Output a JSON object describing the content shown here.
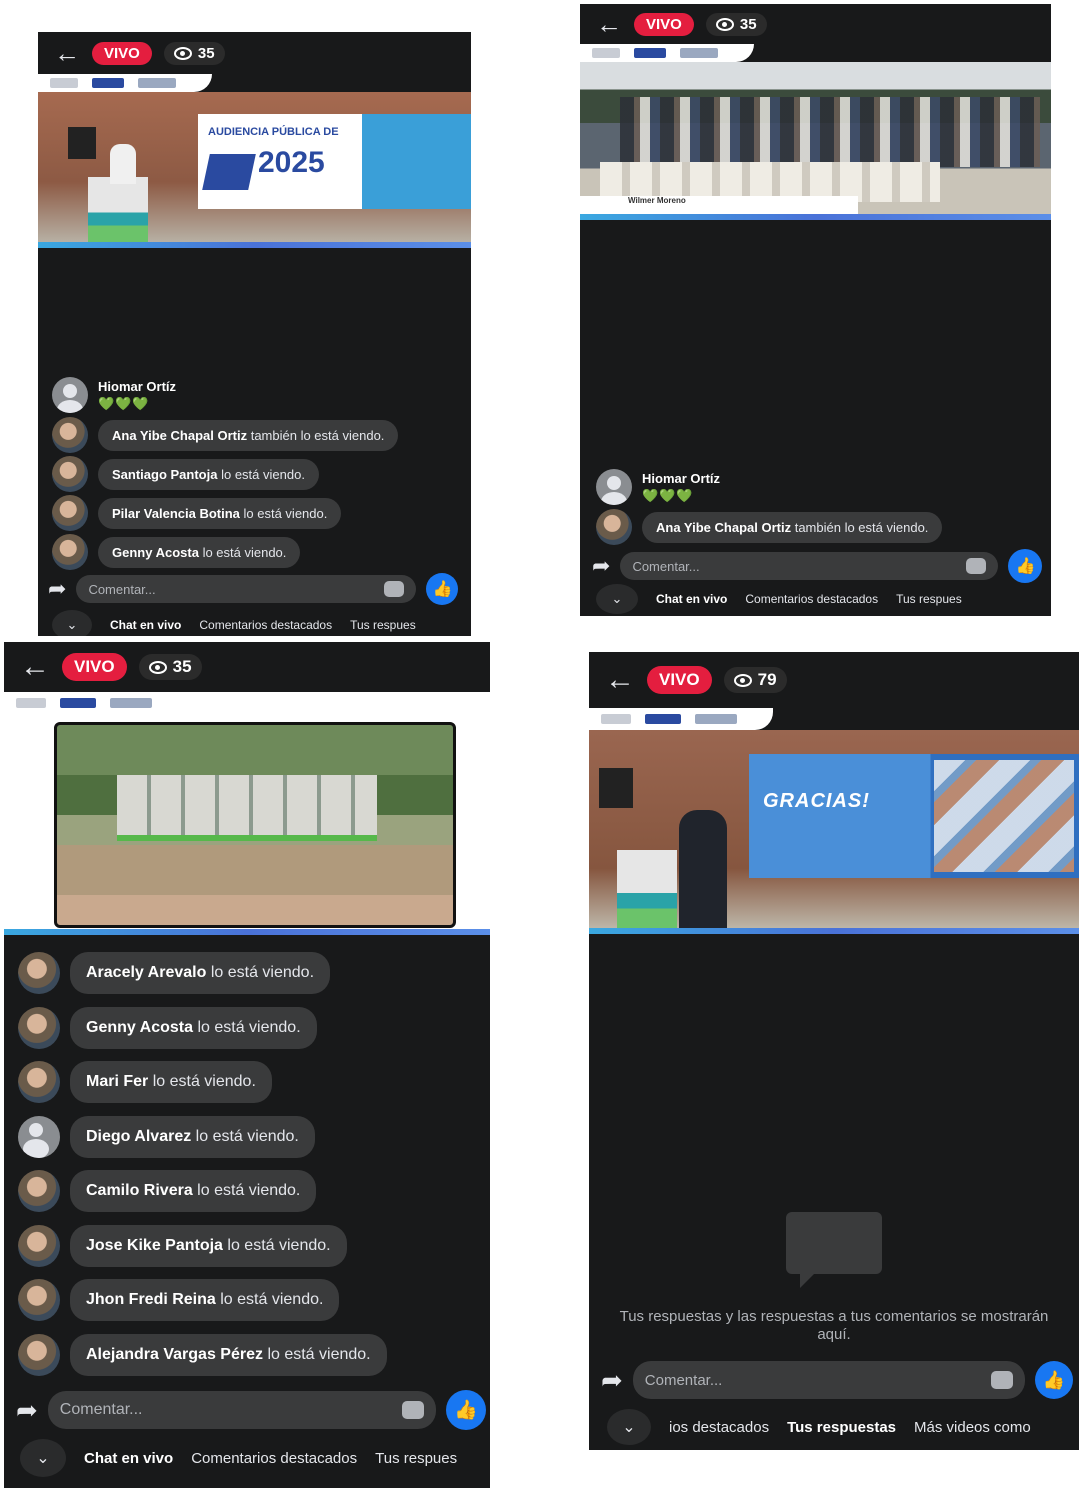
{
  "panels": {
    "p1": {
      "live_badge": "VIVO",
      "view_count": "35",
      "comments": [
        {
          "name": "Hiomar Ortíz",
          "hearts": "💚💚💚"
        },
        {
          "name": "Ana Yibe Chapal Ortiz",
          "text": "también lo está viendo."
        },
        {
          "name": "Santiago Pantoja",
          "text": "lo está viendo."
        },
        {
          "name": "Pilar Valencia Botina",
          "text": "lo está viendo."
        },
        {
          "name": "Genny Acosta",
          "text": "lo está viendo."
        }
      ],
      "comment_placeholder": "Comentar...",
      "tabs": [
        "Chat en vivo",
        "Comentarios destacados",
        "Tus respues"
      ],
      "screen_title": "AUDIENCIA PÚBLICA DE",
      "screen_year": "2025"
    },
    "p2": {
      "live_badge": "VIVO",
      "view_count": "35",
      "caption_name": "Wilmer Moreno",
      "comments": [
        {
          "name": "Hiomar Ortíz",
          "hearts": "💚💚💚"
        },
        {
          "name": "Ana Yibe Chapal Ortiz",
          "text": "también lo está viendo."
        }
      ],
      "comment_placeholder": "Comentar...",
      "tabs": [
        "Chat en vivo",
        "Comentarios destacados",
        "Tus respues"
      ]
    },
    "p3": {
      "live_badge": "VIVO",
      "view_count": "35",
      "comments": [
        {
          "name": "Aracely Arevalo",
          "text": "lo está viendo."
        },
        {
          "name": "Genny Acosta",
          "text": "lo está viendo."
        },
        {
          "name": "Mari Fer",
          "text": "lo está viendo."
        },
        {
          "name": "Diego Alvarez",
          "text": "lo está viendo."
        },
        {
          "name": "Camilo Rivera",
          "text": "lo está viendo."
        },
        {
          "name": "Jose Kike Pantoja",
          "text": "lo está viendo."
        },
        {
          "name": "Jhon Fredi Reina",
          "text": "lo está viendo."
        },
        {
          "name": "Alejandra Vargas Pérez",
          "text": "lo está viendo."
        }
      ],
      "comment_placeholder": "Comentar...",
      "tabs": [
        "Chat en vivo",
        "Comentarios destacados",
        "Tus respues"
      ]
    },
    "p4": {
      "live_badge": "VIVO",
      "view_count": "79",
      "screen_title": "GRACIAS!",
      "empty_message": "Tus respuestas y las respuestas a tus comentarios se mostrarán aquí.",
      "comment_placeholder": "Comentar...",
      "tabs": [
        "ios destacados",
        "Tus respuestas",
        "Más videos como"
      ]
    }
  },
  "colors": {
    "live_red": "#e41e3f",
    "fb_blue": "#1877f2",
    "panel_bg": "#18191a",
    "bubble_bg": "#3a3b3c"
  }
}
